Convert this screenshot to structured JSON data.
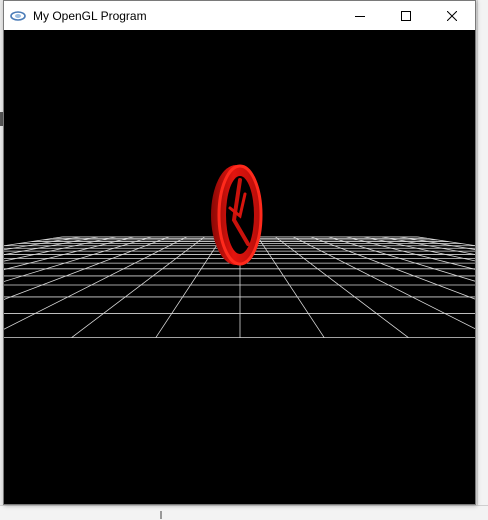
{
  "window": {
    "title": "My OpenGL Program",
    "icon": "opengl-app-icon",
    "controls": [
      {
        "name": "minimize-button",
        "icon": "minimize-icon"
      },
      {
        "name": "maximize-button",
        "icon": "maximize-icon"
      },
      {
        "name": "close-button",
        "icon": "close-icon"
      }
    ]
  },
  "scene": {
    "background_color": "#000000",
    "grid_color": "#d8d8d8",
    "object_color": "#e3140e",
    "objects": [
      "floor-grid",
      "red-wheel"
    ]
  }
}
